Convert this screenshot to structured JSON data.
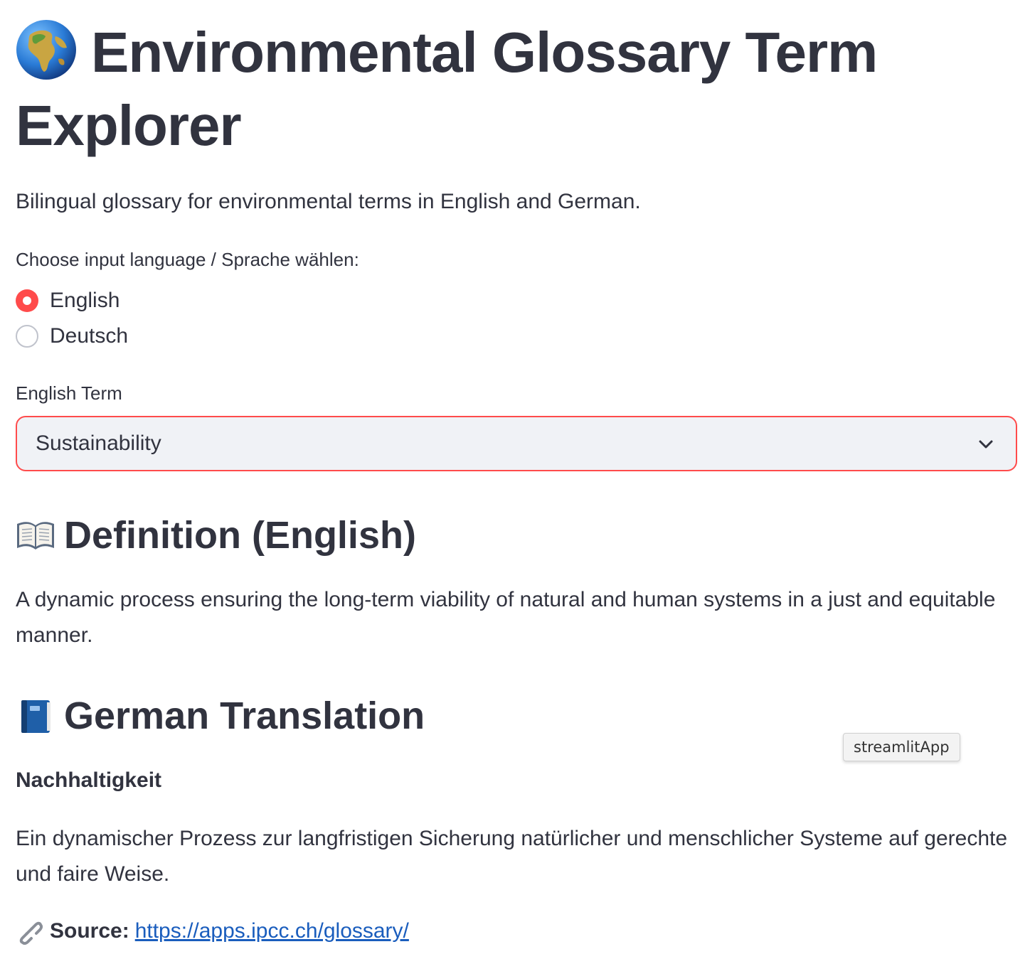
{
  "app": {
    "title": "Environmental Glossary Term Explorer",
    "subtitle": "Bilingual glossary for environmental terms in English and German."
  },
  "language_radio": {
    "label": "Choose input language / Sprache wählen:",
    "options": [
      {
        "label": "English",
        "selected": true
      },
      {
        "label": "Deutsch",
        "selected": false
      }
    ]
  },
  "term_select": {
    "label": "English Term",
    "value": "Sustainability"
  },
  "definition": {
    "heading": "Definition (English)",
    "text": "A dynamic process ensuring the long-term viability of natural and human systems in a just and equitable manner."
  },
  "translation": {
    "heading": "German Translation",
    "term": "Nachhaltigkeit",
    "text": "Ein dynamischer Prozess zur langfristigen Sicherung natürlicher und menschlicher Systeme auf gerechte und faire Weise."
  },
  "source": {
    "label": "Source:",
    "url": "https://apps.ipcc.ch/glossary/"
  },
  "tooltip": {
    "text": "streamlitApp"
  },
  "icons": {
    "title": "globe-icon",
    "definition": "open-book-icon",
    "translation": "blue-book-icon",
    "source": "link-icon",
    "select": "chevron-down-icon"
  },
  "colors": {
    "accent": "#ff4b4b",
    "text": "#31333f",
    "select_bg": "#f0f2f6",
    "link": "#1a5dbd"
  }
}
